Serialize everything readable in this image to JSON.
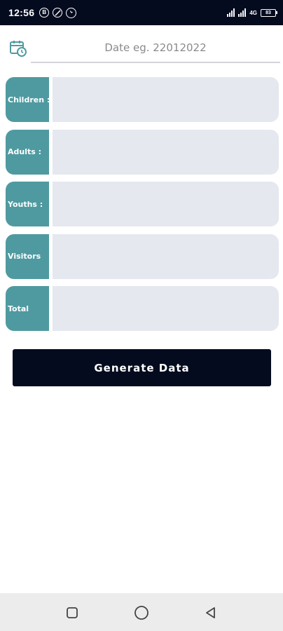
{
  "status_bar": {
    "time": "12:56",
    "notification_icons": [
      "b-icon",
      "do-not-disturb-icon",
      "whatsapp-icon"
    ],
    "network_label": "4G",
    "battery": "83"
  },
  "date_field": {
    "placeholder": "Date eg. 22012022",
    "value": ""
  },
  "rows": [
    {
      "label": "Children :",
      "value": ""
    },
    {
      "label": "Adults      :",
      "value": ""
    },
    {
      "label": "Youths      :",
      "value": ""
    },
    {
      "label": "Visitors",
      "value": ""
    },
    {
      "label": "Total",
      "value": ""
    }
  ],
  "generate_button": {
    "label": "Generate Data"
  },
  "nav_bar": {
    "icons": [
      "recent-apps-icon",
      "home-icon",
      "back-icon"
    ]
  },
  "colors": {
    "header": "#050b1f",
    "label_teal": "#4f9aa0",
    "field_bg": "#e5e8ef",
    "nav_bg": "#ececec"
  }
}
